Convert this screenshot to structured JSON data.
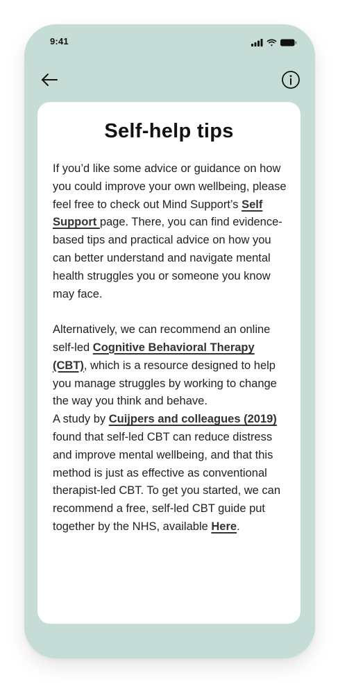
{
  "status_bar": {
    "time": "9:41"
  },
  "nav": {
    "back_icon": "arrow-left-icon",
    "info_icon": "info-circle-icon"
  },
  "colors": {
    "phone_background": "#c6ddd7",
    "card_background": "#ffffff",
    "text": "#222222",
    "link": "#333333"
  },
  "page": {
    "title": "Self-help tips",
    "para1": {
      "before_link": "If you’d like some advice or guidance on how you could improve your own wellbeing, please feel free to check out Mind Support’s ",
      "link": "Self Support ",
      "after_link": "page. There, you can find evidence-based tips and practical advice on how you can better understand and navigate mental health struggles you or someone you know may face."
    },
    "para2": {
      "before_link": "Alternatively, we can recommend an online self-led ",
      "link": "Cognitive Behavioral Therapy (CBT)",
      "after_link": ", which is a resource designed to help you manage struggles by working to change the way you think and behave."
    },
    "para3": {
      "before_link": "A study by ",
      "link": "Cuijpers and colleagues (2019)",
      "after_link": " found that self-led CBT can reduce distress and improve mental wellbeing, and that this method is just as effective as conventional therapist-led CBT. To get you started, we can recommend a free, self-led CBT guide put together by the NHS, available ",
      "link2": "Here",
      "end": "."
    }
  }
}
